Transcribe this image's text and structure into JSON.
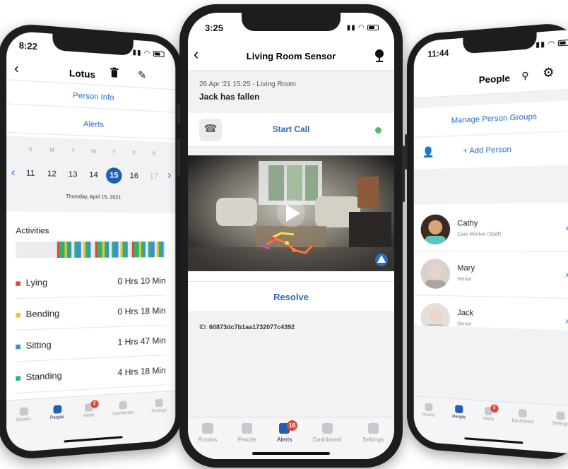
{
  "left_phone": {
    "status_time": "8:22",
    "title": "Lotus",
    "menu": {
      "person_info": "Person Info",
      "alerts": "Alerts"
    },
    "calendar": {
      "weekdays": [
        "S",
        "M",
        "T",
        "W",
        "T",
        "F",
        "S"
      ],
      "days": [
        "11",
        "12",
        "13",
        "14",
        "15",
        "16",
        "17"
      ],
      "selected_day": "15",
      "date_caption": "Thursday, April 15, 2021"
    },
    "activities_heading": "Activities",
    "activities": [
      {
        "label": "Lying",
        "value": "0 Hrs 10 Min",
        "color": "#e2473a"
      },
      {
        "label": "Bending",
        "value": "0 Hrs 18 Min",
        "color": "#f2c12e"
      },
      {
        "label": "Sitting",
        "value": "1 Hrs 47 Min",
        "color": "#3a8fd8"
      },
      {
        "label": "Standing",
        "value": "4 Hrs 18 Min",
        "color": "#2fb36c"
      }
    ],
    "tabs": [
      {
        "label": "Rooms",
        "icon": "bed-icon"
      },
      {
        "label": "People",
        "icon": "person-icon"
      },
      {
        "label": "Alerts",
        "icon": "bell-icon",
        "badge": "2"
      },
      {
        "label": "Dashboard",
        "icon": "chart-icon"
      },
      {
        "label": "Settings",
        "icon": "gear-icon"
      }
    ],
    "active_tab": "People"
  },
  "center_phone": {
    "status_time": "3:25",
    "title": "Living Room Sensor",
    "alert_meta": "26 Apr '21 15:25 - Living Room",
    "alert_text": "Jack has fallen",
    "start_call": "Start Call",
    "resolve": "Resolve",
    "id_label": "ID:",
    "id_value": "60873dc7b1aa1732077c4392",
    "online_color": "#5cb85c",
    "tabs": [
      {
        "label": "Rooms",
        "icon": "bed-icon"
      },
      {
        "label": "People",
        "icon": "person-icon"
      },
      {
        "label": "Alerts",
        "icon": "bell-icon",
        "badge": "16"
      },
      {
        "label": "Dashboard",
        "icon": "chart-icon"
      },
      {
        "label": "Settings",
        "icon": "gear-icon"
      }
    ],
    "active_tab": "Alerts"
  },
  "right_phone": {
    "status_time": "11:44",
    "title": "People",
    "manage_groups": "Manage Person Groups",
    "add_person": "+ Add Person",
    "people": [
      {
        "name": "Cathy",
        "role": "Care Worker (Staff)"
      },
      {
        "name": "Mary",
        "role": "Senior"
      },
      {
        "name": "Jack",
        "role": "Senior"
      }
    ],
    "tabs": [
      {
        "label": "Rooms",
        "icon": "bed-icon"
      },
      {
        "label": "People",
        "icon": "person-icon"
      },
      {
        "label": "Alerts",
        "icon": "bell-icon",
        "badge": "3"
      },
      {
        "label": "Dashboard",
        "icon": "chart-icon"
      },
      {
        "label": "Settings",
        "icon": "gear-icon"
      }
    ],
    "active_tab": "People"
  },
  "colors": {
    "accent": "#2b6cc2",
    "selected_day": "#1f5fb4",
    "badge": "#e2473a"
  }
}
